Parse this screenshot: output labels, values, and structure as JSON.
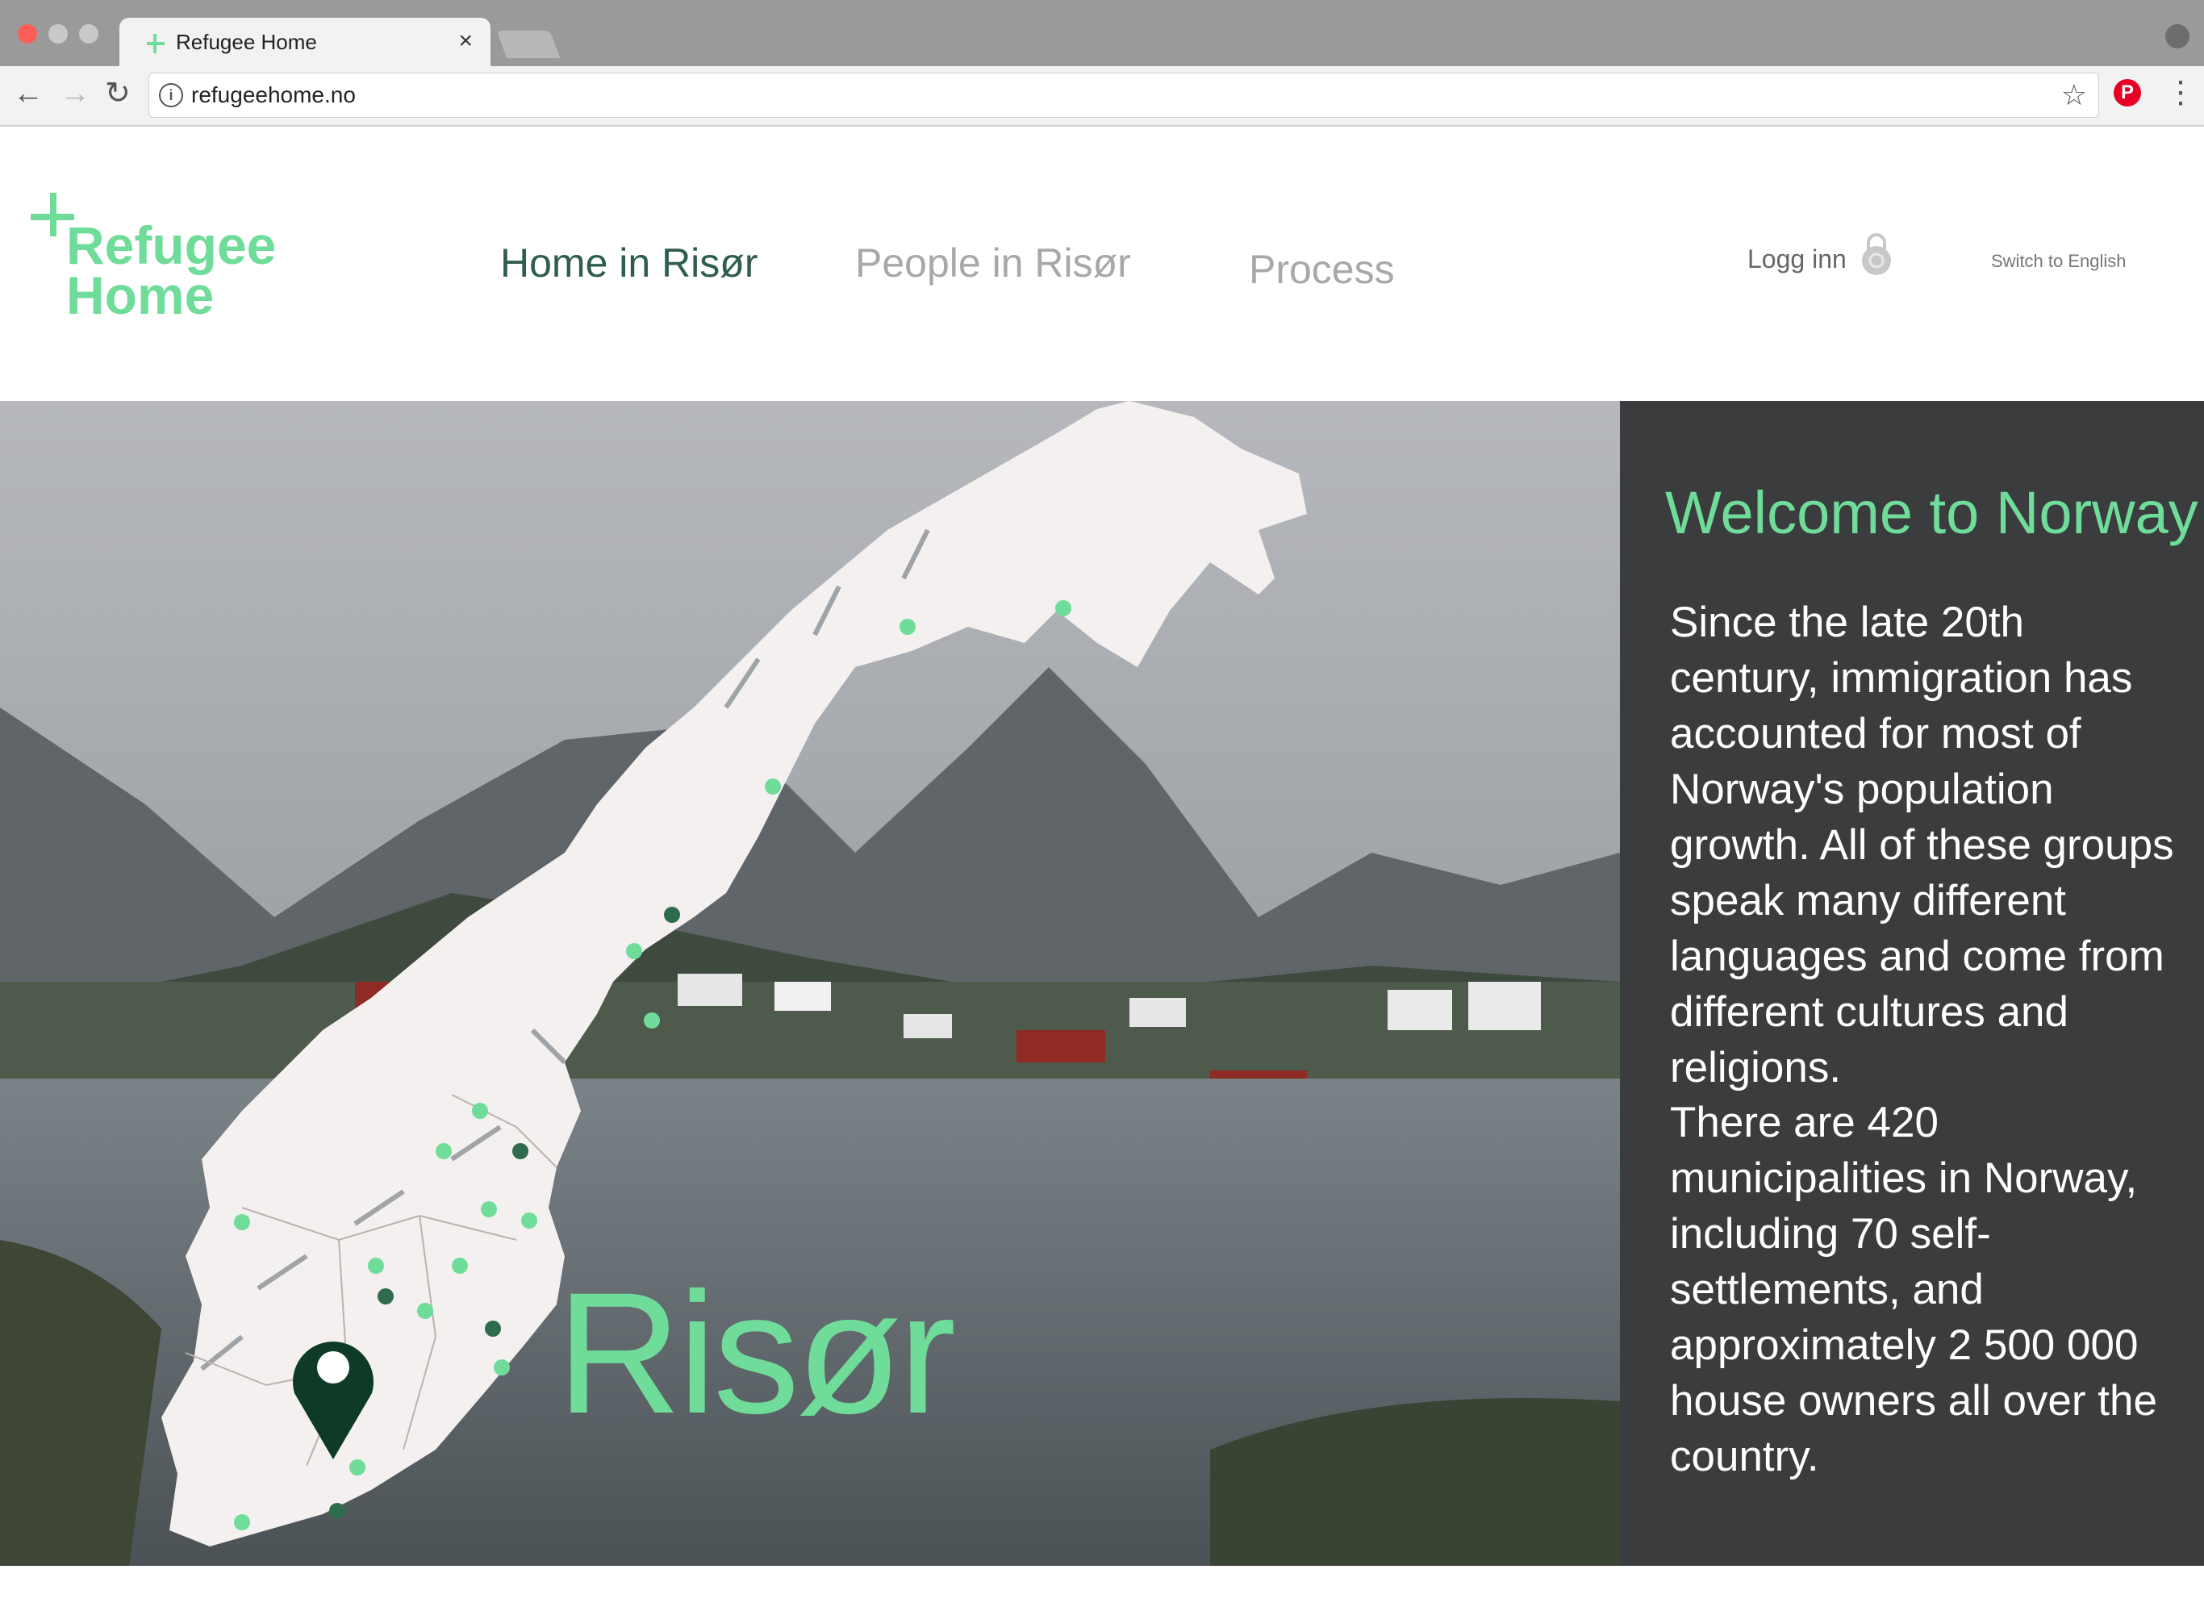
{
  "browser": {
    "tab_title": "Refugee Home",
    "url": "refugeehome.no"
  },
  "site": {
    "logo_line1": "Refugee",
    "logo_line2": "Home",
    "nav": {
      "home": "Home in Risør",
      "people": "People in Risør",
      "process": "Process"
    },
    "login": "Logg inn",
    "language": "Switch to English"
  },
  "hero": {
    "place_name": "Risør"
  },
  "panel": {
    "title": "Welcome to Norway",
    "paragraph1": "Since the late 20th century, immigration has accounted for most of Norway's population growth. All of these groups speak many different languages and come from different cultures and religions.",
    "paragraph2": "There are 420 municipalities in Norway, including 70 self-settlements, and approximately 2 500 000 house owners all over the country."
  },
  "colors": {
    "brand_green": "#6fdc9a",
    "active_nav": "#2f5e4a",
    "inactive_nav": "#a8a8a8",
    "map_fill": "#f4f0ef",
    "dot_light": "#6fdc9a",
    "dot_dark": "#2f6b4d",
    "pin": "#0e3a26",
    "panel_bg": "#303234"
  }
}
